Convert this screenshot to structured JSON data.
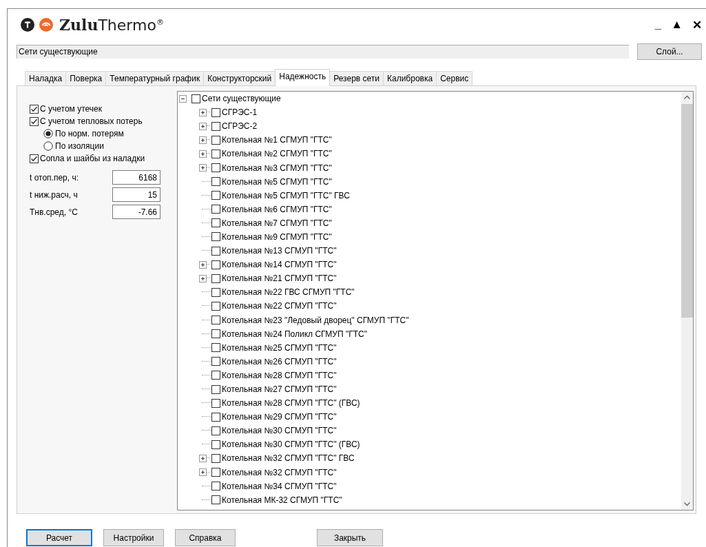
{
  "window": {
    "title": "**Zulu**Thermo$^{®}$",
    "controls": [
      "_",
      "▲",
      "✕"
    ]
  },
  "layer": {
    "value": "Сети существующие",
    "button": "Слой..."
  },
  "tabs": [
    {
      "label": "Наладка",
      "selected": false
    },
    {
      "label": "Поверка",
      "selected": false
    },
    {
      "label": "Температурный график",
      "selected": false
    },
    {
      "label": "Конструкторский",
      "selected": false
    },
    {
      "label": "Надежность",
      "selected": true
    },
    {
      "label": "Резерв сети",
      "selected": false
    },
    {
      "label": "Калибровка",
      "selected": false
    },
    {
      "label": "Сервис",
      "selected": false
    }
  ],
  "options": [
    {
      "kind": "checkbox",
      "label": "С учетом утечек",
      "checked": true
    },
    {
      "kind": "checkbox",
      "label": "С учетом тепловых потерь",
      "checked": true
    },
    {
      "kind": "radio",
      "label": "По норм. потерям",
      "selected": true
    },
    {
      "kind": "radio",
      "label": "По изоляции",
      "selected": false
    },
    {
      "kind": "checkbox",
      "label": "Сопла и шайбы из наладки",
      "checked": true
    }
  ],
  "fields": [
    {
      "label": "t отоп.пер, ч:",
      "value": "6168"
    },
    {
      "label": "t ниж.расч, ч",
      "value": "15"
    },
    {
      "label": "Тнв.сред, °С",
      "value": "-7.66"
    }
  ],
  "tree": {
    "label": "Сети существующие",
    "checked": false,
    "expanded": true,
    "children": [
      {
        "label": "СГРЭС-1",
        "kind": "group",
        "checked": false
      },
      {
        "label": "СГРЭС-2",
        "kind": "group",
        "checked": false
      },
      {
        "label": "Котельная №1 СГМУП \"ГТС\"",
        "kind": "group",
        "checked": false
      },
      {
        "label": "Котельная №2 СГМУП \"ГТС\"",
        "kind": "group",
        "checked": false
      },
      {
        "label": "Котельная №3 СГМУП \"ГТС\"",
        "kind": "group",
        "checked": false
      },
      {
        "label": "Котельная №5 СГМУП \"ГТС\"",
        "kind": "leaf",
        "checked": false
      },
      {
        "label": "Котельная №5 СГМУП \"ГТС\" ГВС",
        "kind": "leaf",
        "checked": false
      },
      {
        "label": "Котельная №6 СГМУП \"ГТС\"",
        "kind": "leaf",
        "checked": false
      },
      {
        "label": "Котельная №7 СГМУП \"ГТС\"",
        "kind": "leaf",
        "checked": false
      },
      {
        "label": "Котельная №9 СГМУП \"ГТС\"",
        "kind": "leaf",
        "checked": false
      },
      {
        "label": "Котельная №13 СГМУП \"ГТС\"",
        "kind": "leaf",
        "checked": false
      },
      {
        "label": "Котельная №14 СГМУП \"ГТС\"",
        "kind": "group",
        "checked": false
      },
      {
        "label": "Котельная №21 СГМУП \"ГТС\"",
        "kind": "group",
        "checked": false
      },
      {
        "label": "Котельная №22 ГВС СГМУП \"ГТС\"",
        "kind": "leaf",
        "checked": false
      },
      {
        "label": "Котельная №22 СГМУП \"ГТС\"",
        "kind": "leaf",
        "checked": false
      },
      {
        "label": "Котельная №23 \"Ледовый дворец\" СГМУП \"ГТС\"",
        "kind": "leaf",
        "checked": false
      },
      {
        "label": "Котельная №24 Поликл СГМУП \"ГТС\"",
        "kind": "leaf",
        "checked": false
      },
      {
        "label": "Котельная №25 СГМУП \"ГТС\"",
        "kind": "leaf",
        "checked": false
      },
      {
        "label": "Котельная №26 СГМУП \"ГТС\"",
        "kind": "leaf",
        "checked": false
      },
      {
        "label": "Котельная №28 СГМУП \"ГТС\"",
        "kind": "leaf",
        "checked": false
      },
      {
        "label": "Котельная №27 СГМУП \"ГТС\"",
        "kind": "leaf",
        "checked": false
      },
      {
        "label": "Котельная №28 СГМУП \"ГТС\" (ГВС)",
        "kind": "leaf",
        "checked": false
      },
      {
        "label": "Котельная №29 СГМУП \"ГТС\"",
        "kind": "leaf",
        "checked": false
      },
      {
        "label": "Котельная №30 СГМУП \"ГТС\"",
        "kind": "leaf",
        "checked": false
      },
      {
        "label": "Котельная №30 СГМУП \"ГТС\" (ГВС)",
        "kind": "leaf",
        "checked": false
      },
      {
        "label": "Котельная №32 СГМУП \"ГТС\" ГВС",
        "kind": "group",
        "checked": false
      },
      {
        "label": "Котельная №32 СГМУП \"ГТС\"",
        "kind": "group",
        "checked": false
      },
      {
        "label": "Котельная №34  СГМУП \"ГТС\"",
        "kind": "leaf",
        "checked": false
      },
      {
        "label": "Котельная МК-32 СГМУП \"ГТС\"",
        "kind": "leaf",
        "checked": false
      }
    ]
  },
  "buttons": [
    {
      "label": "Расчет",
      "default": true
    },
    {
      "label": "Настройки",
      "default": false
    },
    {
      "label": "Справка",
      "default": false
    },
    {
      "label": "Закрыть",
      "default": false
    }
  ]
}
